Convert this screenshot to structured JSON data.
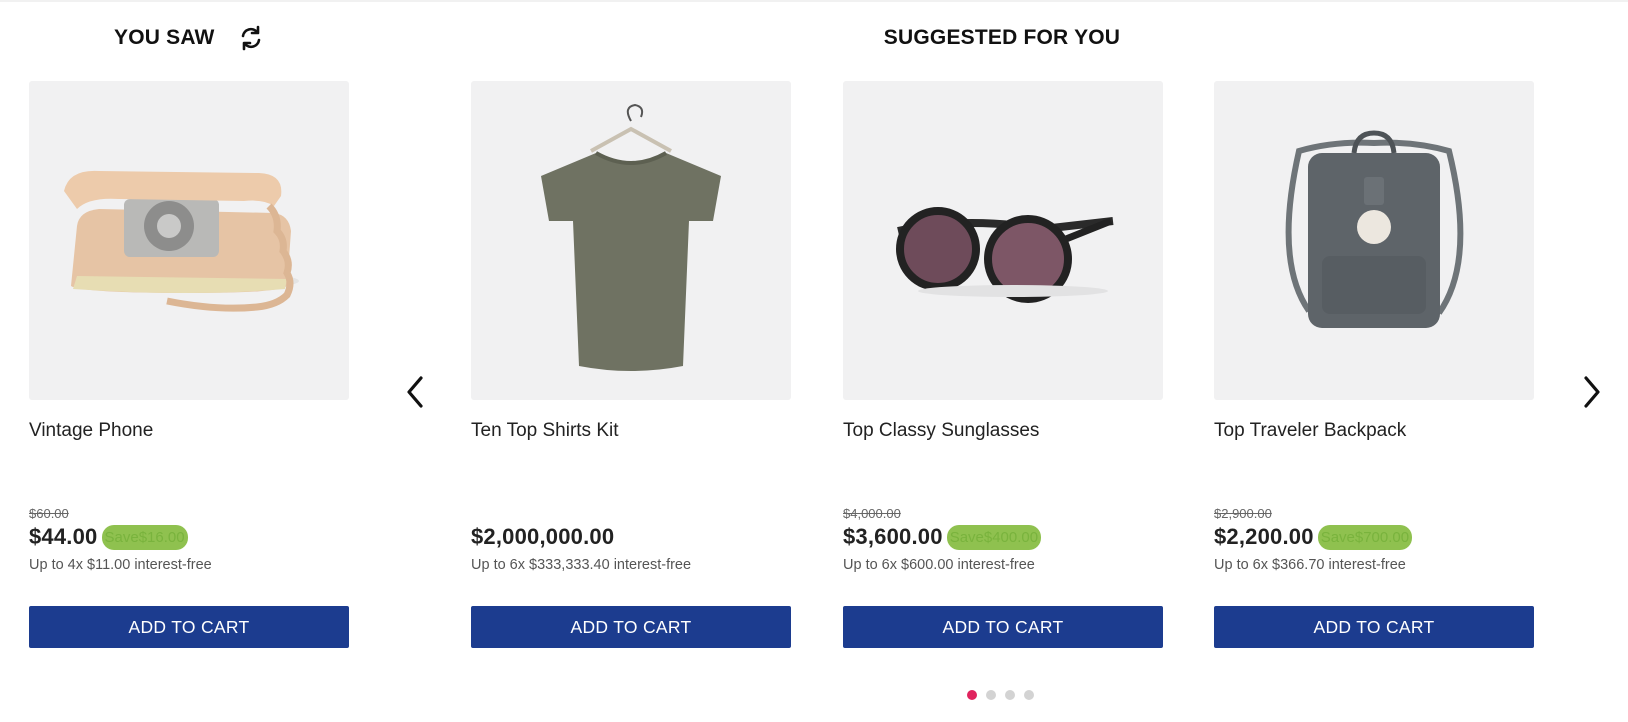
{
  "you_saw": {
    "title": "YOU SAW",
    "refresh_icon": "refresh-icon",
    "product": {
      "name": "Vintage Phone",
      "old_price": "$60.00",
      "price": "$44.00",
      "save": "Save$16.00",
      "installments": "Up to 4x $11.00 interest-free",
      "button": "ADD TO CART",
      "image": "vintage-phone-image"
    }
  },
  "suggested": {
    "title": "SUGGESTED FOR YOU",
    "prev_icon": "chevron-left-icon",
    "next_icon": "chevron-right-icon",
    "products": [
      {
        "name": "Ten Top Shirts Kit",
        "old_price": "",
        "price": "$2,000,000.00",
        "save": "",
        "installments": "Up to 6x $333,333.40 interest-free",
        "button": "ADD TO CART",
        "image": "tshirt-image"
      },
      {
        "name": "Top Classy Sunglasses",
        "old_price": "$4,000.00",
        "price": "$3,600.00",
        "save": "Save$400.00",
        "installments": "Up to 6x $600.00 interest-free",
        "button": "ADD TO CART",
        "image": "sunglasses-image"
      },
      {
        "name": "Top Traveler Backpack",
        "old_price": "$2,900.00",
        "price": "$2,200.00",
        "save": "Save$700.00",
        "installments": "Up to 6x $366.70 interest-free",
        "button": "ADD TO CART",
        "image": "backpack-image"
      }
    ],
    "pagination": {
      "pages": 4,
      "active": 1
    }
  },
  "colors": {
    "button": "#1c3c8f",
    "save_badge": "#8fc14f",
    "active_dot": "#e0245e",
    "image_bg": "#f1f1f2"
  }
}
